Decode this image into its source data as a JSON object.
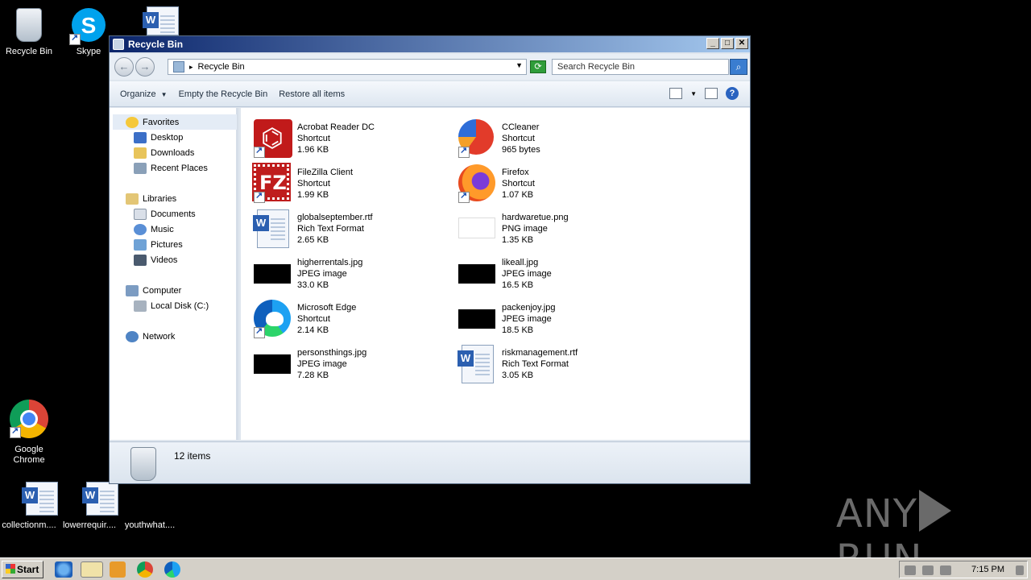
{
  "desktop": {
    "icons": [
      {
        "label": "Recycle Bin",
        "icon": "recycle-bin-icon"
      },
      {
        "label": "Skype",
        "icon": "skype-icon"
      },
      {
        "label": "",
        "icon": "word-document-icon"
      },
      {
        "label": "Google Chrome",
        "icon": "chrome-icon"
      },
      {
        "label": "collectionm....",
        "icon": "word-document-icon"
      },
      {
        "label": "lowerrequir....",
        "icon": "word-document-icon"
      },
      {
        "label": "youthwhat....",
        "icon": "blank-file-icon"
      }
    ]
  },
  "window": {
    "title": "Recycle Bin",
    "address": "Recycle Bin",
    "search_placeholder": "Search Recycle Bin",
    "toolbar": {
      "organize": "Organize",
      "empty": "Empty the Recycle Bin",
      "restore": "Restore all items"
    },
    "nav": {
      "favorites": "Favorites",
      "desktop": "Desktop",
      "downloads": "Downloads",
      "recent": "Recent Places",
      "libraries": "Libraries",
      "documents": "Documents",
      "music": "Music",
      "pictures": "Pictures",
      "videos": "Videos",
      "computer": "Computer",
      "localdisk": "Local Disk (C:)",
      "network": "Network"
    },
    "files": [
      {
        "name": "Acrobat Reader DC",
        "type": "Shortcut",
        "size": "1.96 KB",
        "icon": "acrobat-icon"
      },
      {
        "name": "CCleaner",
        "type": "Shortcut",
        "size": "965 bytes",
        "icon": "ccleaner-icon"
      },
      {
        "name": "FileZilla Client",
        "type": "Shortcut",
        "size": "1.99 KB",
        "icon": "filezilla-icon"
      },
      {
        "name": "Firefox",
        "type": "Shortcut",
        "size": "1.07 KB",
        "icon": "firefox-icon"
      },
      {
        "name": "globalseptember.rtf",
        "type": "Rich Text Format",
        "size": "2.65 KB",
        "icon": "rtf-document-icon"
      },
      {
        "name": "hardwaretue.png",
        "type": "PNG image",
        "size": "1.35 KB",
        "icon": "png-thumbnail-icon"
      },
      {
        "name": "higherrentals.jpg",
        "type": "JPEG image",
        "size": "33.0 KB",
        "icon": "jpeg-thumbnail-icon"
      },
      {
        "name": "likeall.jpg",
        "type": "JPEG image",
        "size": "16.5 KB",
        "icon": "jpeg-thumbnail-icon"
      },
      {
        "name": "Microsoft Edge",
        "type": "Shortcut",
        "size": "2.14 KB",
        "icon": "edge-icon"
      },
      {
        "name": "packenjoy.jpg",
        "type": "JPEG image",
        "size": "18.5 KB",
        "icon": "jpeg-thumbnail-icon"
      },
      {
        "name": "personsthings.jpg",
        "type": "JPEG image",
        "size": "7.28 KB",
        "icon": "jpeg-thumbnail-icon"
      },
      {
        "name": "riskmanagement.rtf",
        "type": "Rich Text Format",
        "size": "3.05 KB",
        "icon": "rtf-document-icon"
      }
    ],
    "status": "12 items"
  },
  "taskbar": {
    "start": "Start",
    "clock": "7:15 PM"
  },
  "watermark": {
    "left": "ANY",
    "right": "RUN"
  }
}
